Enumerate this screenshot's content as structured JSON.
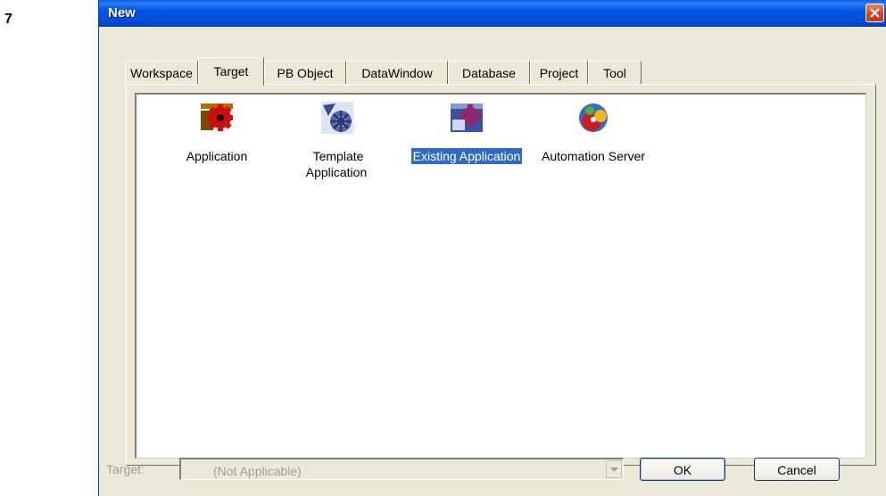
{
  "step_number": "7",
  "window": {
    "title": "New"
  },
  "tabs": [
    {
      "label": "Workspace",
      "selected": false
    },
    {
      "label": "Target",
      "selected": true
    },
    {
      "label": "PB Object",
      "selected": false
    },
    {
      "label": "DataWindow",
      "selected": false
    },
    {
      "label": "Database",
      "selected": false
    },
    {
      "label": "Project",
      "selected": false
    },
    {
      "label": "Tool",
      "selected": false
    }
  ],
  "items": [
    {
      "label": "Application",
      "icon": "application-gear-icon",
      "selected": false
    },
    {
      "label": "Template\nApplication",
      "icon": "template-application-icon",
      "selected": false
    },
    {
      "label": "Existing Application",
      "icon": "existing-application-icon",
      "selected": true
    },
    {
      "label": "Automation Server",
      "icon": "automation-server-icon",
      "selected": false
    }
  ],
  "target": {
    "label": "Target:",
    "value": "(Not Applicable)",
    "enabled": false
  },
  "buttons": {
    "ok": "OK",
    "cancel": "Cancel"
  },
  "colors": {
    "titlebar": "#0054e3",
    "selection": "#316ac5",
    "dialog_face": "#ece9d8",
    "close": "#d54a2c"
  }
}
